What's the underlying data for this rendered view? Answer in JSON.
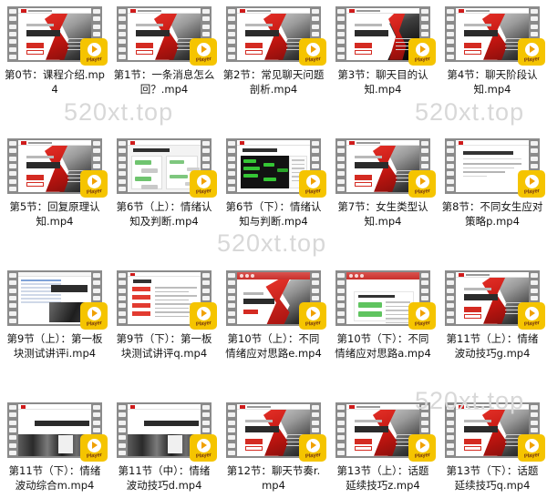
{
  "view": {
    "type": "file-thumbnail-grid",
    "columns": 5,
    "rows": 4,
    "badge_label": "Player",
    "badge_color": "#f5c400",
    "film_frame_color": "#8b8b8b",
    "screen_color": "#1b1b1b",
    "background": "#ffffff",
    "caption_color": "#141414"
  },
  "watermarks": [
    {
      "text": "520xt.top"
    },
    {
      "text": "520xt.top"
    },
    {
      "text": "520xt.top"
    },
    {
      "text": "520xt.top"
    }
  ],
  "items": [
    {
      "index": 0,
      "name": "第0节：课程介绍.mp4",
      "thumb": "cover",
      "badge": "Player"
    },
    {
      "index": 1,
      "name": "第1节：一条消息怎么回？.mp4",
      "thumb": "cover",
      "badge": "Player"
    },
    {
      "index": 2,
      "name": "第2节：常见聊天问题剖析.mp4",
      "thumb": "cover",
      "badge": "Player"
    },
    {
      "index": 3,
      "name": "第3节：聊天目的认知.mp4",
      "thumb": "cover-dark",
      "badge": "Player"
    },
    {
      "index": 4,
      "name": "第4节：聊天阶段认知.mp4",
      "thumb": "cover",
      "badge": "Player"
    },
    {
      "index": 5,
      "name": "第5节：回复原理认知.mp4",
      "thumb": "cover",
      "badge": "Player"
    },
    {
      "index": 6,
      "name": "第6节（上）：情绪认知及判断.mp4",
      "thumb": "chat",
      "badge": "Player"
    },
    {
      "index": 7,
      "name": "第6节（下）：情绪认知与判断.mp4",
      "thumb": "flow-dark",
      "badge": "Player"
    },
    {
      "index": 8,
      "name": "第7节：女生类型认知.mp4",
      "thumb": "cover",
      "badge": "Player"
    },
    {
      "index": 9,
      "name": "第8节：不同女生应对策略p.mp4",
      "thumb": "doc",
      "badge": "Player"
    },
    {
      "index": 10,
      "name": "第9节（上）：第一板块测试讲评i.mp4",
      "thumb": "sheet",
      "badge": "Player"
    },
    {
      "index": 11,
      "name": "第9节（下）：第一板块测试讲评q.mp4",
      "thumb": "reddoc",
      "badge": "Player"
    },
    {
      "index": 12,
      "name": "第10节（上）：不同情绪应对思路e.mp4",
      "thumb": "browser",
      "badge": "Player"
    },
    {
      "index": 13,
      "name": "第10节（下）：不同情绪应对思路a.mp4",
      "thumb": "browser-green",
      "badge": "Player"
    },
    {
      "index": 14,
      "name": "第11节（上）：情绪波动技巧g.mp4",
      "thumb": "cover",
      "badge": "Player"
    },
    {
      "index": 15,
      "name": "第11节（下）：情绪波动综合m.mp4",
      "thumb": "band",
      "badge": "Player"
    },
    {
      "index": 16,
      "name": "第11节（中）：情绪波动技巧d.mp4",
      "thumb": "band",
      "badge": "Player"
    },
    {
      "index": 17,
      "name": "第12节：聊天节奏r.mp4",
      "thumb": "cover",
      "badge": "Player"
    },
    {
      "index": 18,
      "name": "第13节（上）：话题延续技巧z.mp4",
      "thumb": "cover",
      "badge": "Player"
    },
    {
      "index": 19,
      "name": "第13节（下）：话题延续技巧q.mp4",
      "thumb": "cover",
      "badge": "Player"
    }
  ]
}
